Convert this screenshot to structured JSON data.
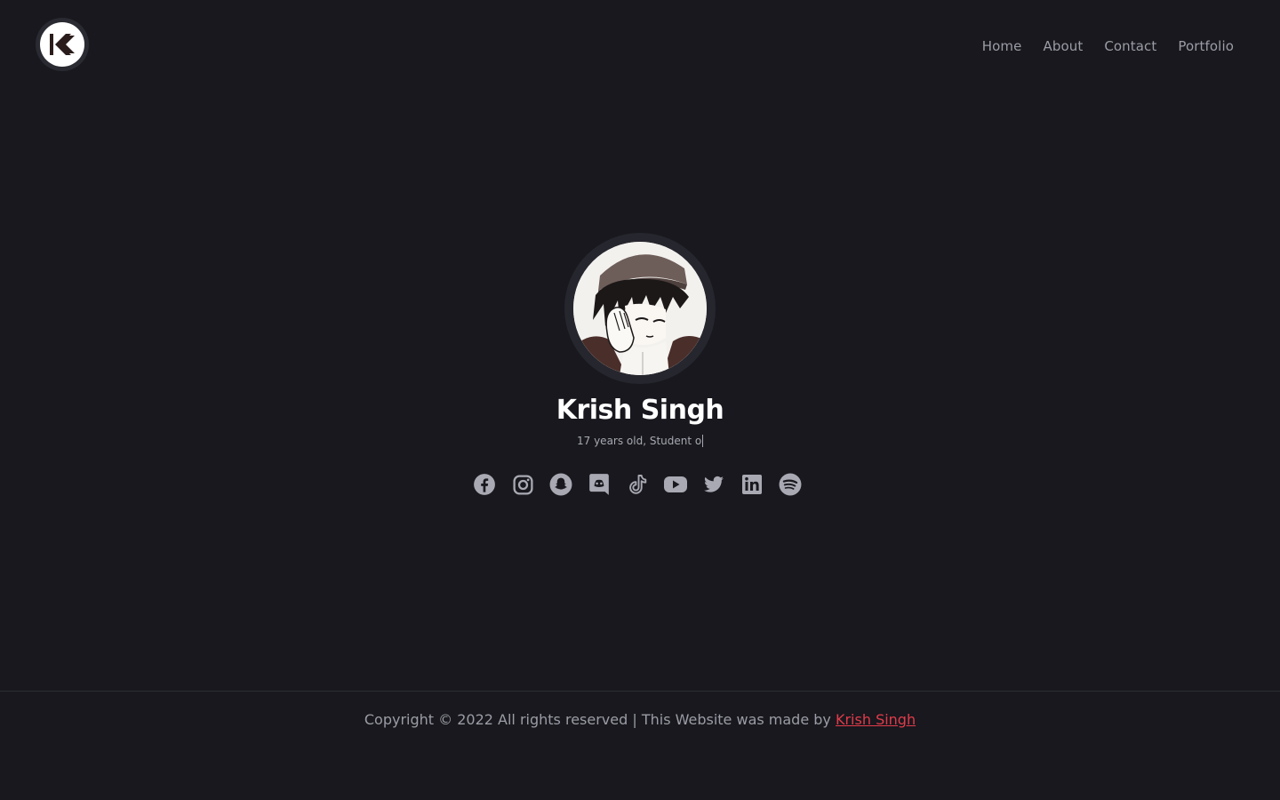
{
  "header": {
    "logo_icon": "kk-logo-icon",
    "nav": [
      {
        "label": "Home"
      },
      {
        "label": "About"
      },
      {
        "label": "Contact"
      },
      {
        "label": "Portfolio"
      }
    ]
  },
  "hero": {
    "avatar_icon": "anime-avatar",
    "name": "Krish Singh",
    "tagline": "17 years old, Student o"
  },
  "socials": [
    {
      "icon": "facebook-icon"
    },
    {
      "icon": "instagram-icon"
    },
    {
      "icon": "snapchat-icon"
    },
    {
      "icon": "discord-icon"
    },
    {
      "icon": "tiktok-icon"
    },
    {
      "icon": "youtube-icon"
    },
    {
      "icon": "twitter-icon"
    },
    {
      "icon": "linkedin-icon"
    },
    {
      "icon": "spotify-icon"
    }
  ],
  "footer": {
    "text": "Copyright © 2022 All rights reserved | This Website was made by ",
    "link": "Krish Singh"
  },
  "colors": {
    "background": "#18181e",
    "text_muted": "#9c9ca6",
    "accent": "#e23b4a"
  }
}
